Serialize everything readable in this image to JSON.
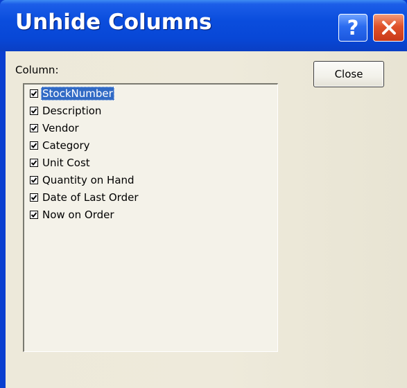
{
  "window": {
    "title": "Unhide Columns",
    "help_glyph": "?"
  },
  "dialog": {
    "column_label": "Column:",
    "close_label": "Close"
  },
  "columns": [
    {
      "label": "StockNumber",
      "checked": true,
      "selected": true
    },
    {
      "label": "Description",
      "checked": true,
      "selected": false
    },
    {
      "label": "Vendor",
      "checked": true,
      "selected": false
    },
    {
      "label": "Category",
      "checked": true,
      "selected": false
    },
    {
      "label": "Unit Cost",
      "checked": true,
      "selected": false
    },
    {
      "label": "Quantity on Hand",
      "checked": true,
      "selected": false
    },
    {
      "label": "Date of Last Order",
      "checked": true,
      "selected": false
    },
    {
      "label": "Now on Order",
      "checked": true,
      "selected": false
    }
  ],
  "icons": {
    "help": "help-icon",
    "close": "close-icon",
    "checkbox": "checkmark-icon"
  },
  "colors": {
    "titlebar": "#0a4ddd",
    "close_red": "#e0522a",
    "selection": "#316ac5",
    "dialog_bg": "#ece9d8"
  }
}
